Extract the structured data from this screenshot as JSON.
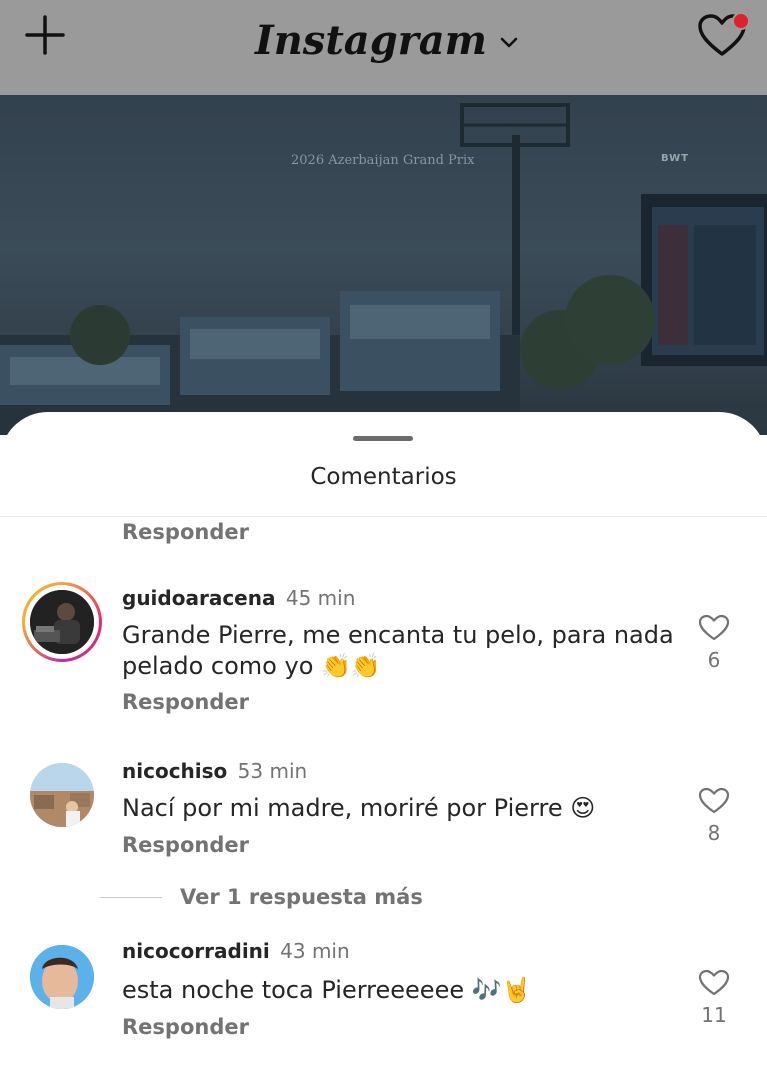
{
  "header": {
    "logo_text": "Instagram",
    "add_icon": "plus-icon",
    "dropdown_icon": "chevron-down-icon",
    "activity_icon": "heart-icon",
    "notification_color": "#e0202b"
  },
  "video": {
    "caption": "2026 Azerbaijan Grand Prix",
    "brand": "BWT"
  },
  "sheet": {
    "title": "Comentarios",
    "reply_label_top": "Responder"
  },
  "comments": [
    {
      "username": "guidoaracena",
      "time": "45 min",
      "text": "Grande Pierre, me encanta tu pelo, para nada pelado como yo",
      "emoji": "👏👏",
      "reply_label": "Responder",
      "likes": "6",
      "has_story": true
    },
    {
      "username": "nicochiso",
      "time": "53 min",
      "text": "Nací por mi madre, moriré por Pierre",
      "emoji": "😍",
      "reply_label": "Responder",
      "likes": "8",
      "has_story": false
    },
    {
      "username": "nicocorradini",
      "time": "43 min",
      "text": "esta noche toca Pierreeeeee",
      "emoji": "🎶🤘",
      "reply_label": "Responder",
      "likes": "11",
      "has_story": false
    }
  ],
  "more_replies": "Ver 1 respuesta más"
}
